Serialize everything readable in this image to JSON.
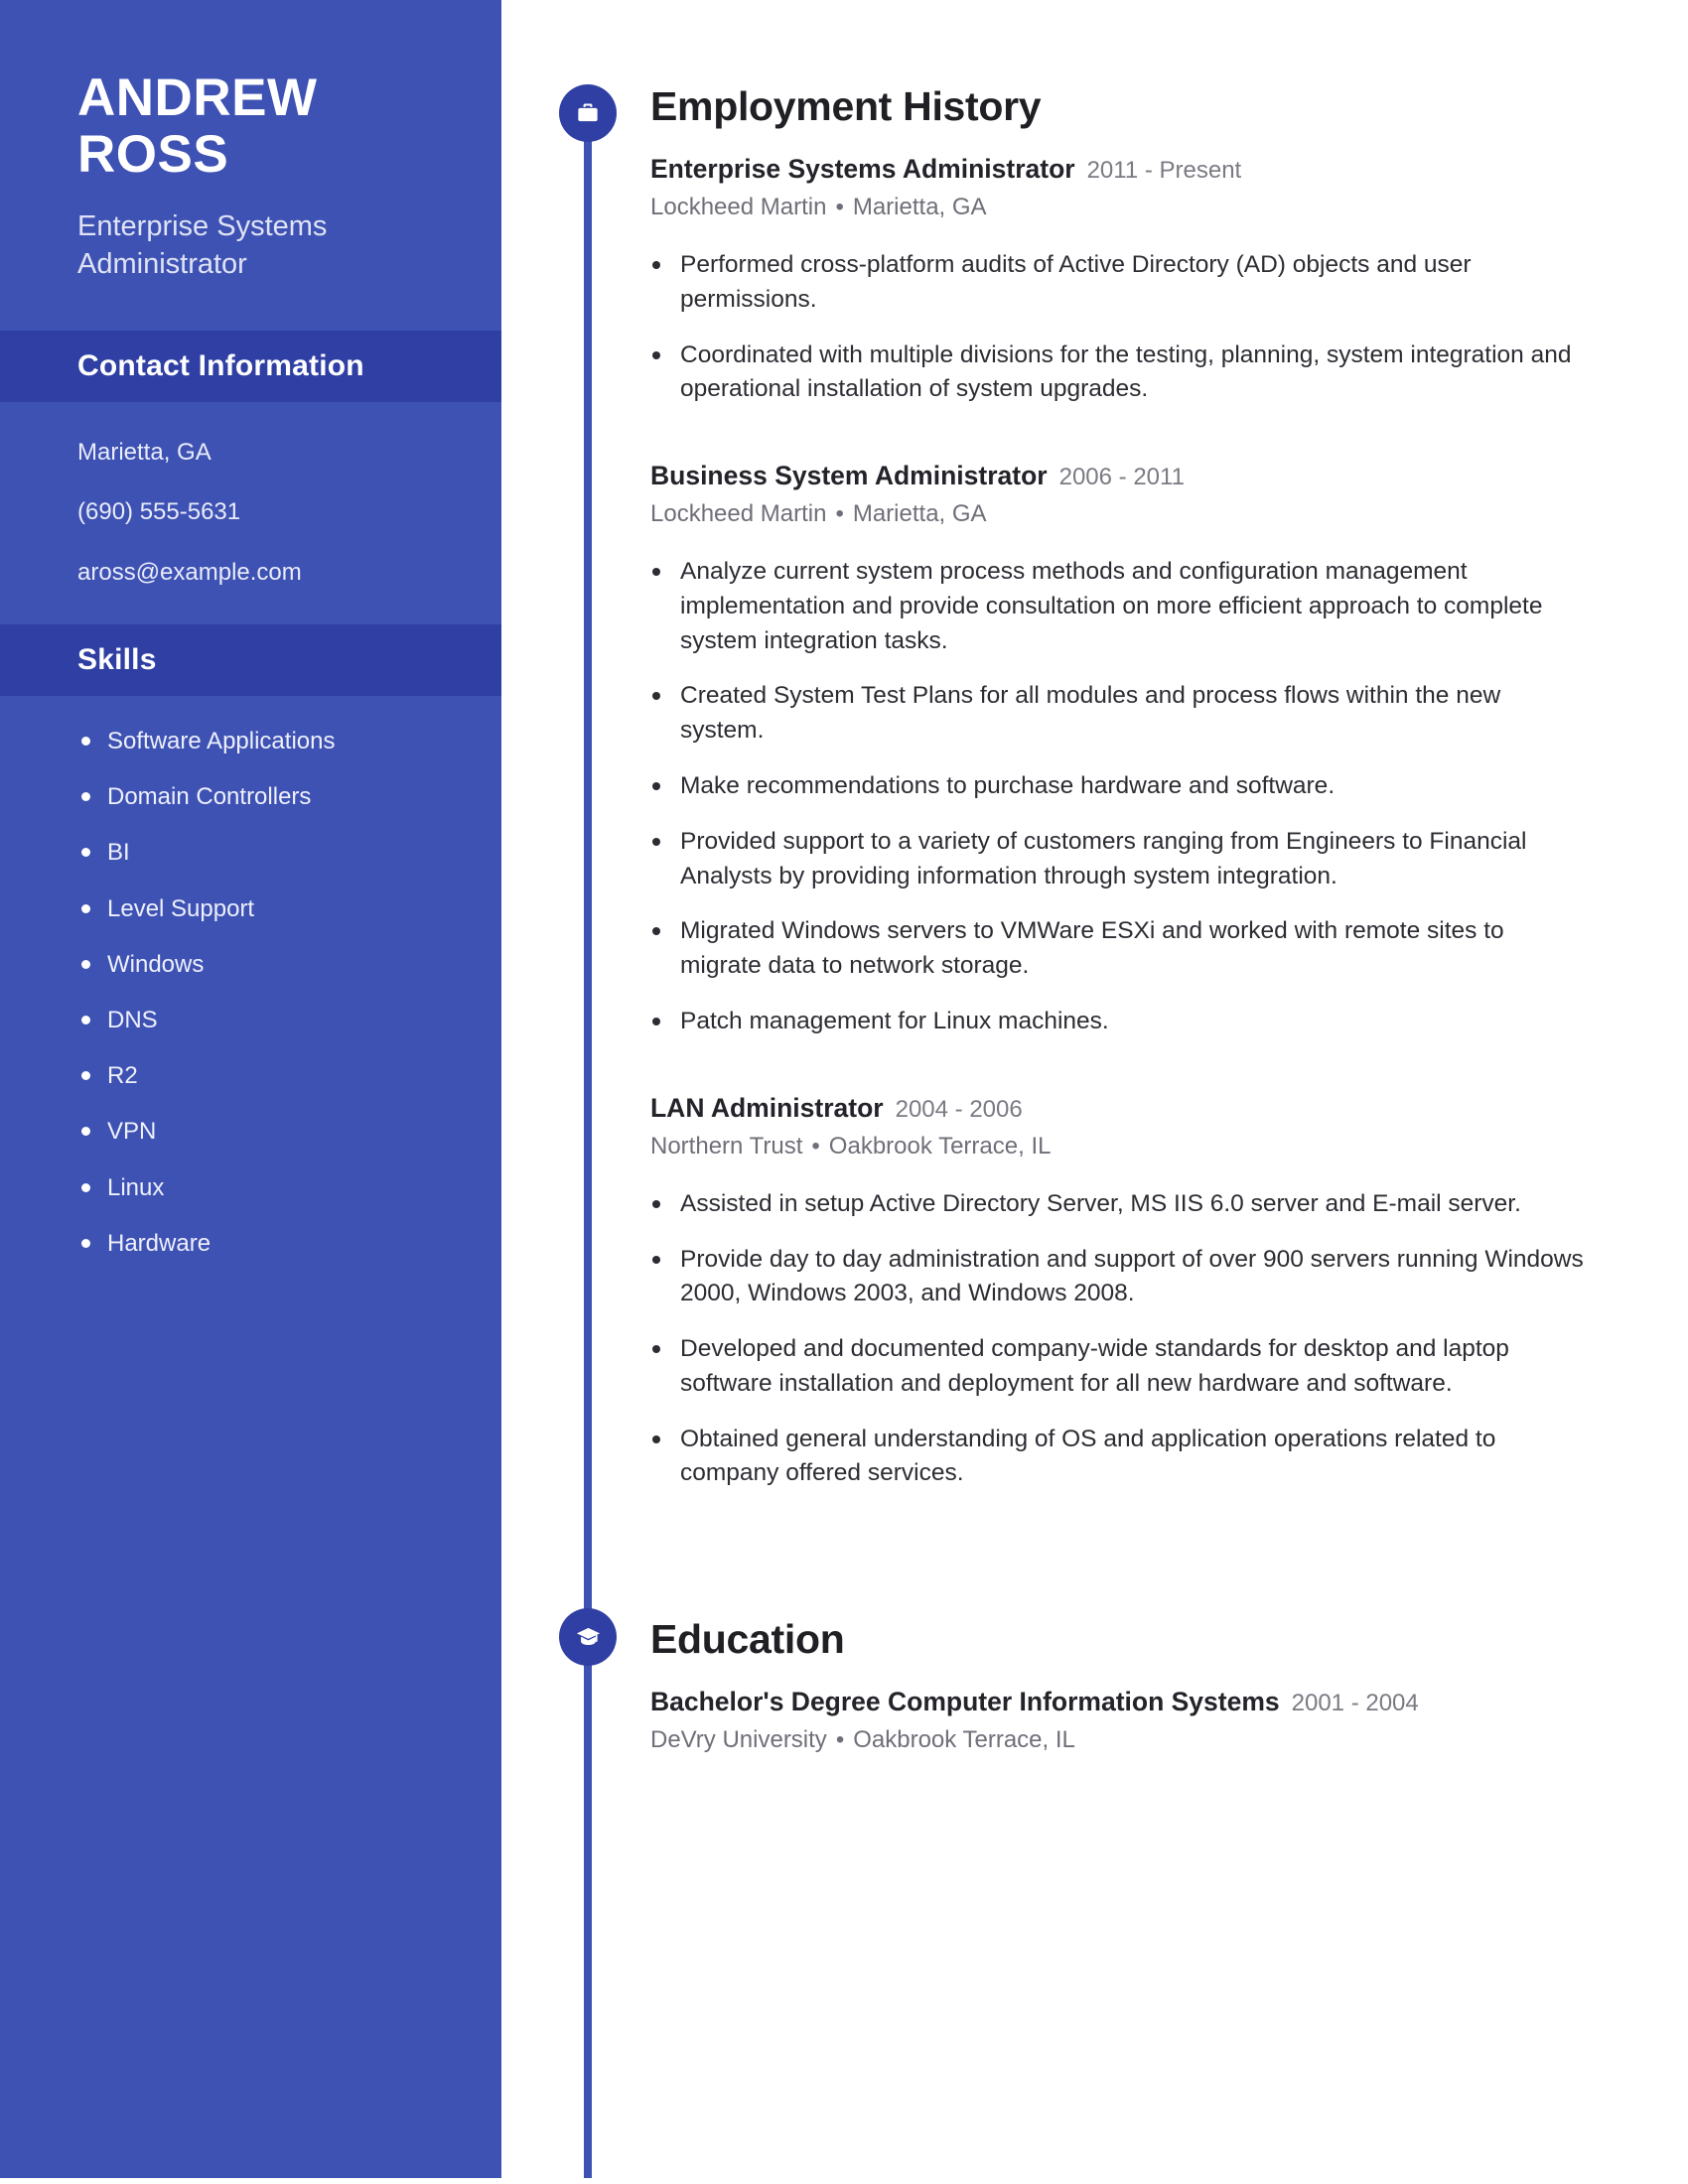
{
  "theme": {
    "sidebar_bg": "#3e52b4",
    "band_bg": "#2f3fa3",
    "accent": "#2f3fa3",
    "timeline": "#3e52b4",
    "text_dark": "#23232a",
    "text_muted": "#6f6f79"
  },
  "sidebar": {
    "name_line1": "ANDREW",
    "name_line2": "ROSS",
    "job_title": "Enterprise Systems Administrator",
    "contact": {
      "heading": "Contact Information",
      "location": "Marietta, GA",
      "phone": "(690) 555-5631",
      "email": "aross@example.com"
    },
    "skills": {
      "heading": "Skills",
      "items": [
        "Software Applications",
        "Domain Controllers",
        "BI",
        "Level Support",
        "Windows",
        "DNS",
        "R2",
        "VPN",
        "Linux",
        "Hardware"
      ]
    }
  },
  "main": {
    "employment": {
      "heading": "Employment History",
      "icon": "briefcase-icon",
      "entries": [
        {
          "title": "Enterprise Systems Administrator",
          "dates": "2011 - Present",
          "company": "Lockheed Martin",
          "location": "Marietta, GA",
          "bullets": [
            "Performed cross-platform audits of Active Directory (AD) objects and user permissions.",
            "Coordinated with multiple divisions for the testing, planning, system integration and operational installation of system upgrades."
          ]
        },
        {
          "title": "Business System Administrator",
          "dates": "2006 - 2011",
          "company": "Lockheed Martin",
          "location": "Marietta, GA",
          "bullets": [
            "Analyze current system process methods and configuration management implementation and provide consultation on more efficient approach to complete system integration tasks.",
            "Created System Test Plans for all modules and process flows within the new system.",
            "Make recommendations to purchase hardware and software.",
            "Provided support to a variety of customers ranging from Engineers to Financial Analysts by providing information through system integration.",
            "Migrated Windows servers to VMWare ESXi and worked with remote sites to migrate data to network storage.",
            "Patch management for Linux machines."
          ]
        },
        {
          "title": "LAN Administrator",
          "dates": "2004 - 2006",
          "company": "Northern Trust",
          "location": "Oakbrook Terrace, IL",
          "bullets": [
            "Assisted in setup Active Directory Server, MS IIS 6.0 server and E-mail server.",
            "Provide day to day administration and support of over 900 servers running Windows 2000, Windows 2003, and Windows 2008.",
            "Developed and documented company-wide standards for desktop and laptop software installation and deployment for all new hardware and software.",
            "Obtained general understanding of OS and application operations related to company offered services."
          ]
        }
      ]
    },
    "education": {
      "heading": "Education",
      "icon": "graduation-cap-icon",
      "entries": [
        {
          "title": "Bachelor's Degree Computer Information Systems",
          "dates": "2001 - 2004",
          "school": "DeVry University",
          "location": "Oakbrook Terrace, IL"
        }
      ]
    },
    "separator": "•"
  }
}
